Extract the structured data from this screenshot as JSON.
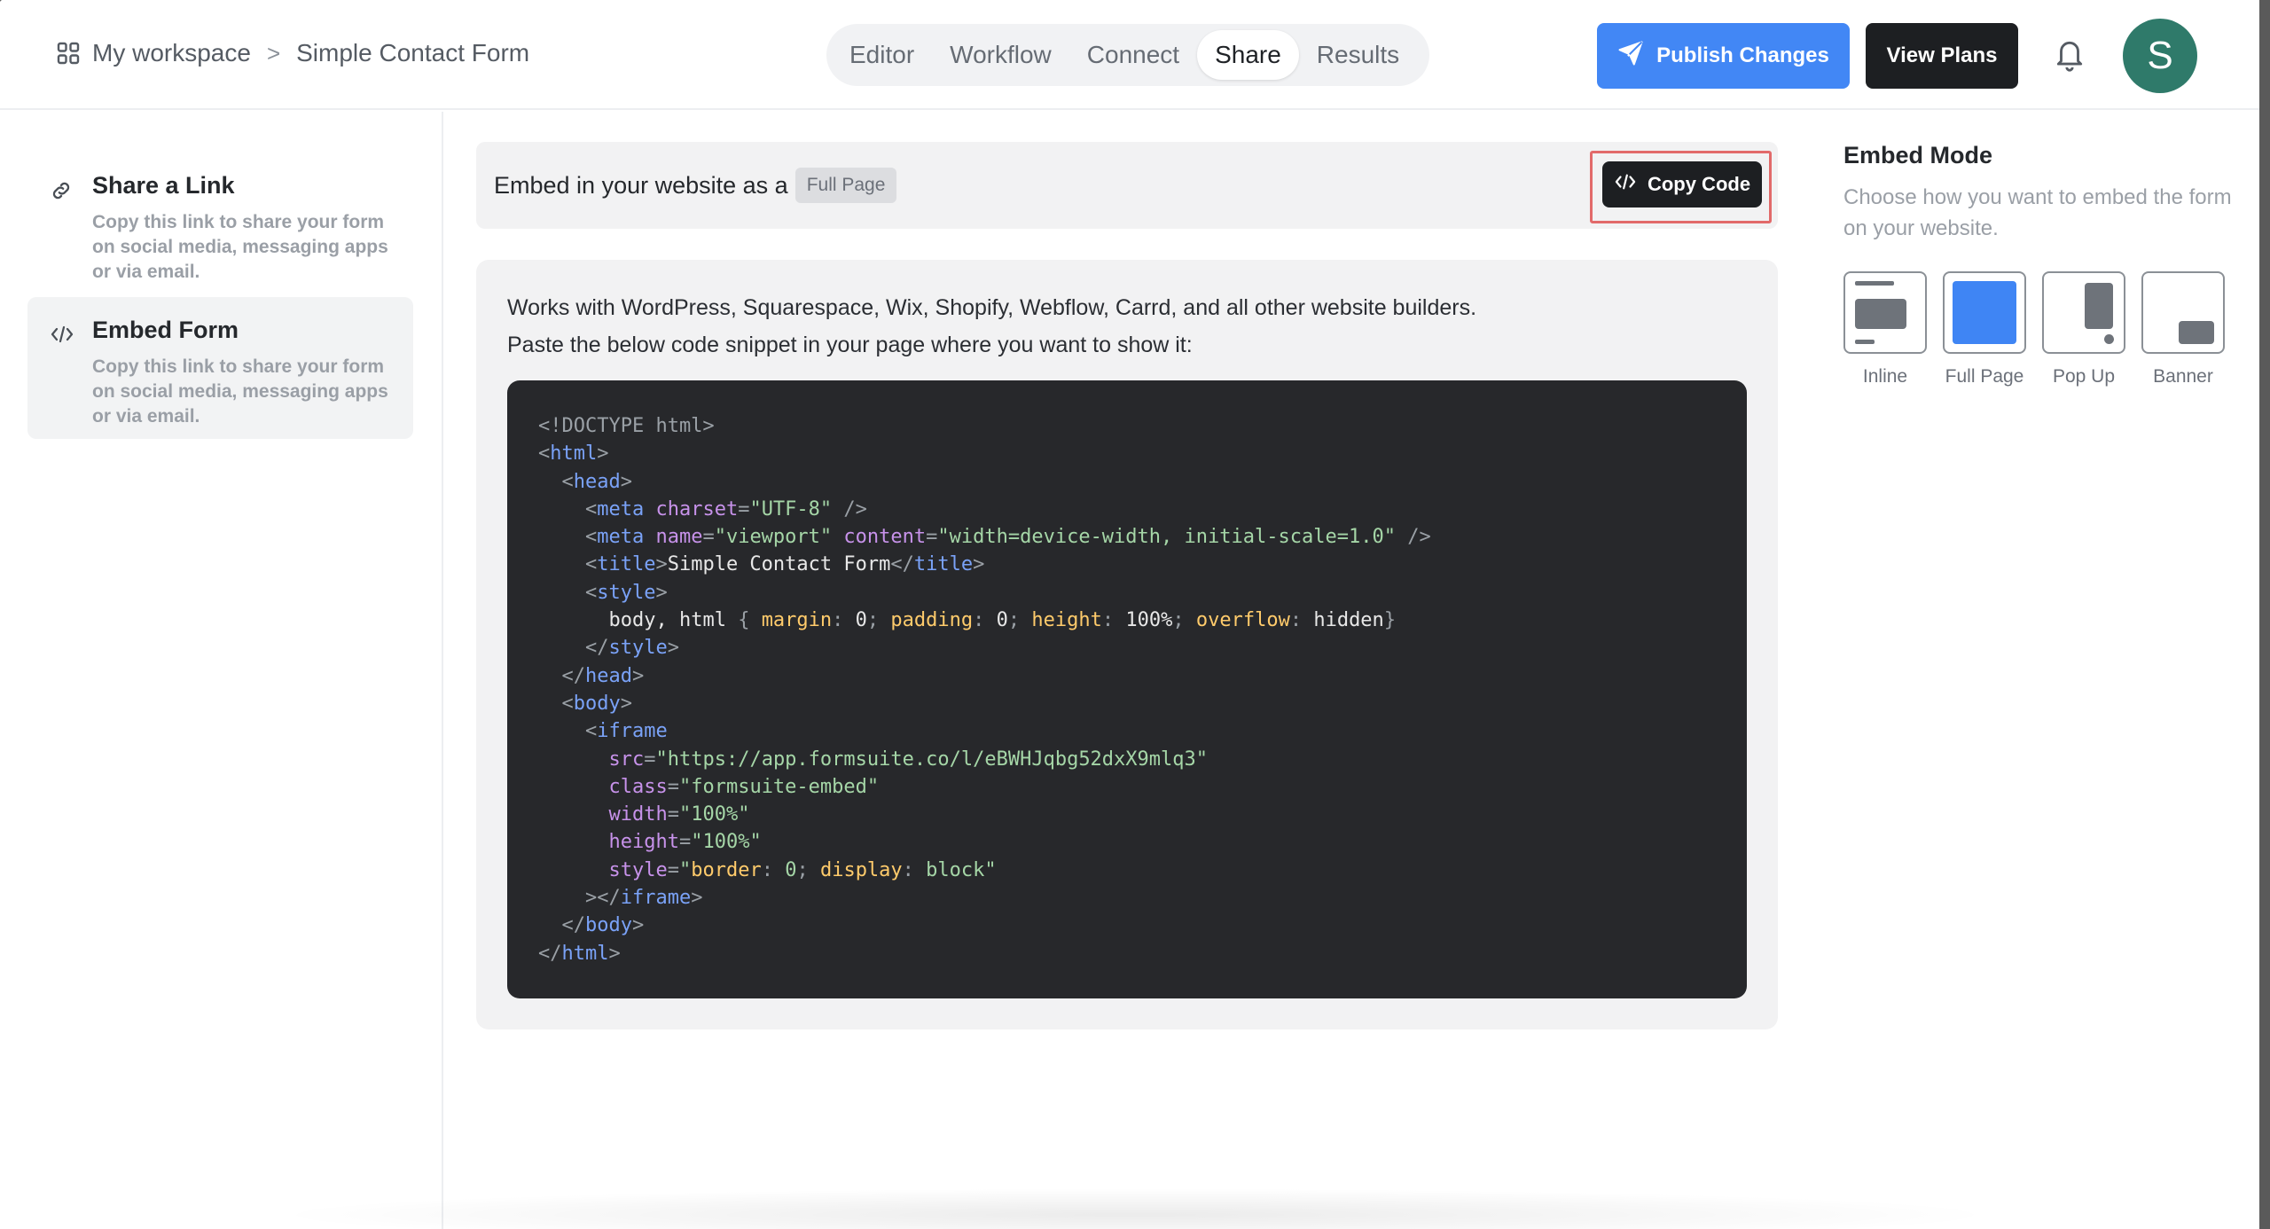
{
  "header": {
    "workspace": "My workspace",
    "separator": ">",
    "form_name": "Simple Contact Form",
    "tabs": [
      {
        "label": "Editor",
        "active": false
      },
      {
        "label": "Workflow",
        "active": false
      },
      {
        "label": "Connect",
        "active": false
      },
      {
        "label": "Share",
        "active": true
      },
      {
        "label": "Results",
        "active": false
      }
    ],
    "publish_label": "Publish Changes",
    "plans_label": "View Plans",
    "avatar_initial": "S",
    "colors": {
      "publish": "#4287f5",
      "avatar": "#2f7a6a"
    }
  },
  "sidebar": {
    "items": [
      {
        "title": "Share a Link",
        "desc": "Copy this link to share your form on social media, messaging apps or via email.",
        "icon": "link-icon",
        "active": false
      },
      {
        "title": "Embed Form",
        "desc": "Copy this link to share your form on social media, messaging apps or via email.",
        "icon": "code-icon",
        "active": true
      }
    ]
  },
  "embed_bar": {
    "label": "Embed in your website as a",
    "mode_badge": "Full Page",
    "copy_label": "Copy Code"
  },
  "snippet_card": {
    "line1": "Works with WordPress, Squarespace, Wix, Shopify, Webflow, Carrd, and all other website builders.",
    "line2": "Paste the below code snippet in your page where you want to show it:",
    "code": {
      "doctype": "<!DOCTYPE html>",
      "charset": "UTF-8",
      "viewport_content": "width=device-width, initial-scale=1.0",
      "title": "Simple Contact Form",
      "style_rule": "body, html { margin: 0; padding: 0; height: 100%; overflow: hidden}",
      "iframe_src": "https://app.formsuite.co/l/eBWHJqbg52dxX9mlq3",
      "iframe_class": "formsuite-embed",
      "iframe_width": "100%",
      "iframe_height": "100%",
      "iframe_style": "border: 0; display: block"
    }
  },
  "embed_mode": {
    "title": "Embed Mode",
    "subtitle": "Choose how you want to embed the form on your website.",
    "options": [
      {
        "label": "Inline",
        "selected": false
      },
      {
        "label": "Full Page",
        "selected": true
      },
      {
        "label": "Pop Up",
        "selected": false
      },
      {
        "label": "Banner",
        "selected": false
      }
    ],
    "accent": "#3f85f4"
  }
}
